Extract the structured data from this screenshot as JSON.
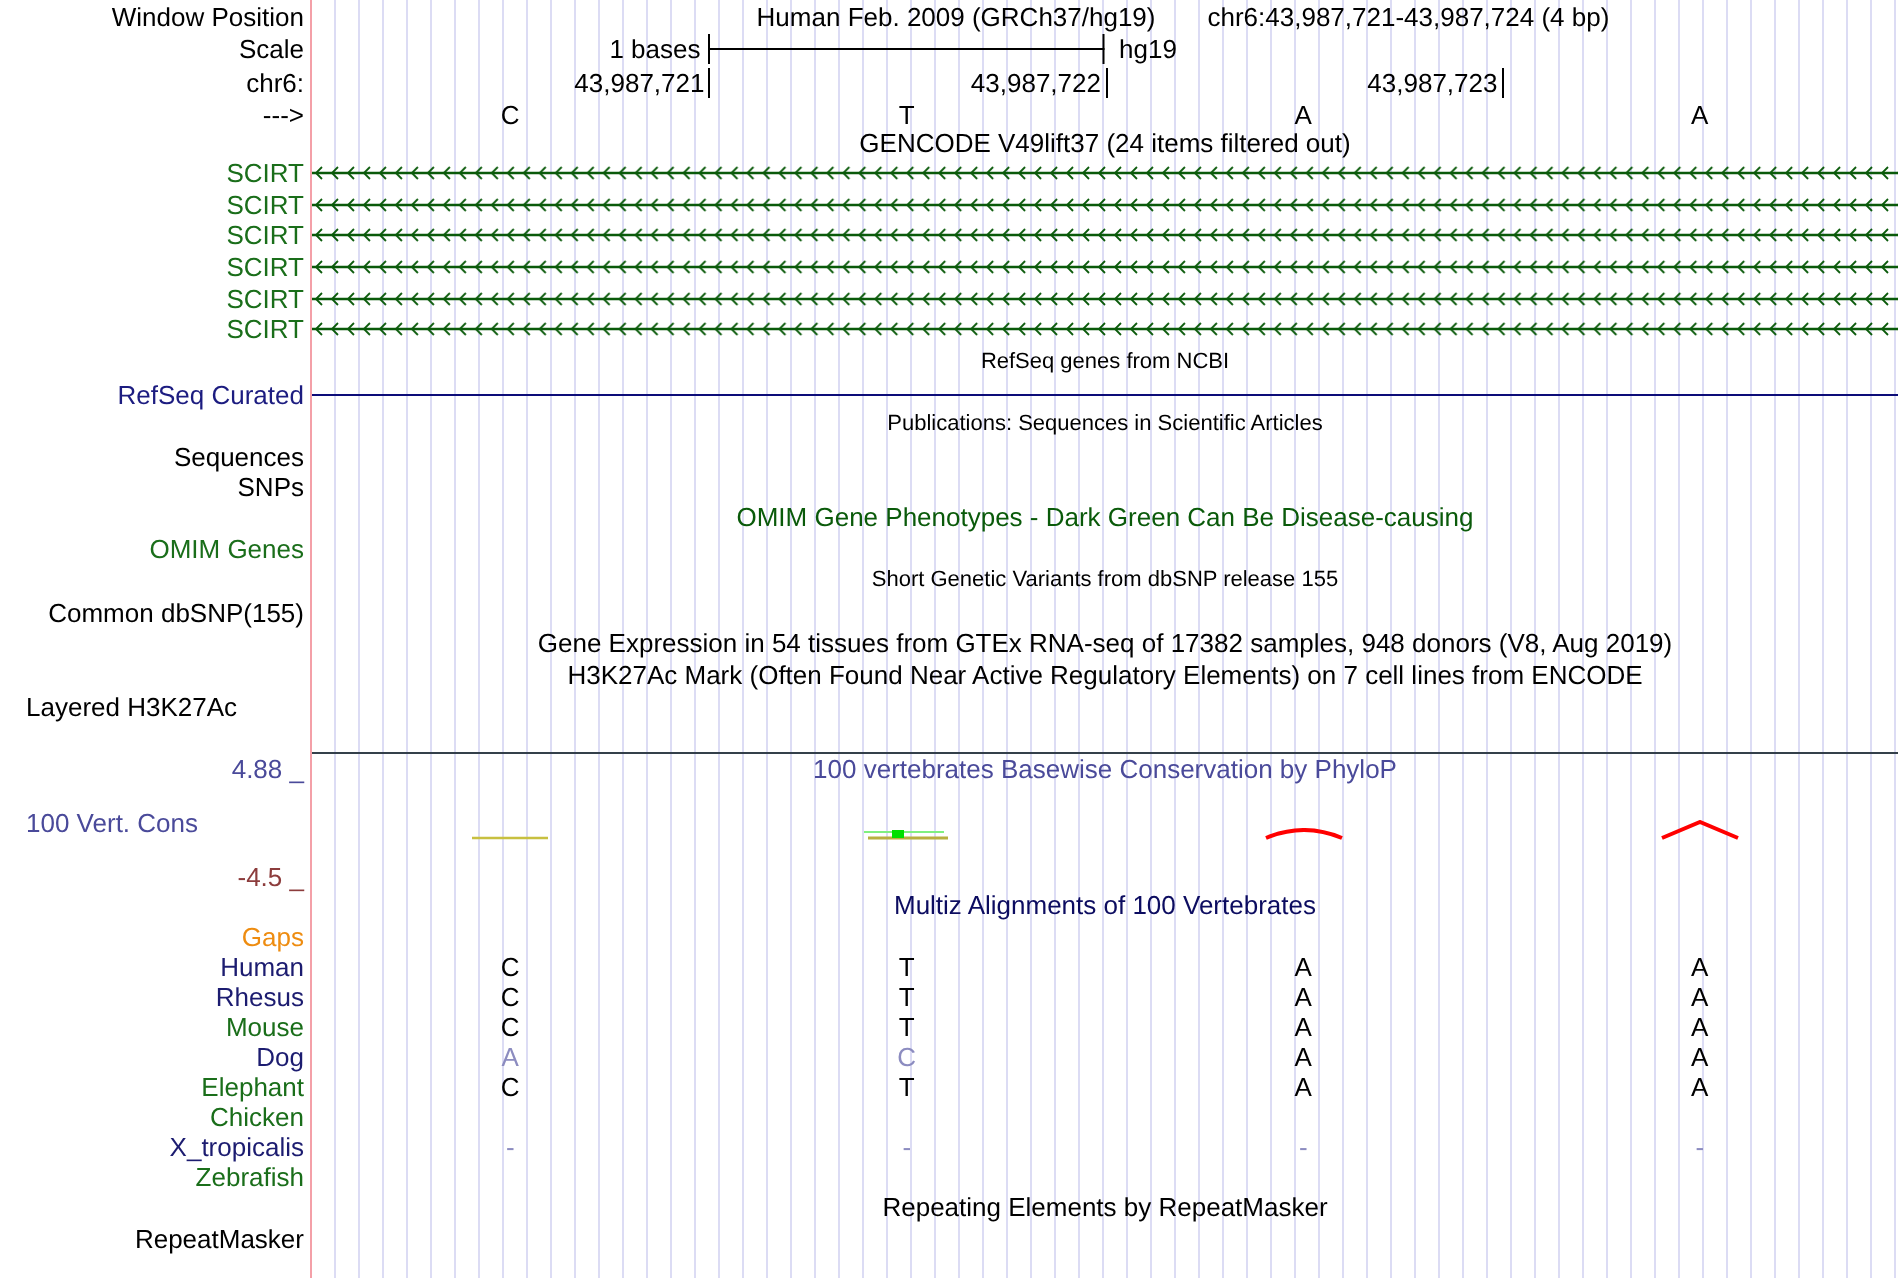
{
  "rows": [
    {
      "kind": "position",
      "label": {
        "text": "Window Position",
        "color": "#000000"
      },
      "texts": [
        "Human Feb. 2009 (GRCh37/hg19)",
        "chr6:43,987,721-43,987,724 (4 bp)"
      ]
    },
    {
      "kind": "scale",
      "label": {
        "text": "Scale",
        "color": "#000000"
      },
      "span": "1 bases",
      "assembly": "hg19"
    },
    {
      "kind": "ruler",
      "label": {
        "text": "chr6:",
        "color": "#000000"
      },
      "ticks": [
        "43,987,721",
        "43,987,722",
        "43,987,723"
      ]
    },
    {
      "kind": "bases",
      "label": {
        "text": "--->",
        "color": "#000000"
      },
      "bases": [
        {
          "base": "C",
          "mismatch": false
        },
        {
          "base": "T",
          "mismatch": false
        },
        {
          "base": "A",
          "mismatch": false
        },
        {
          "base": "A",
          "mismatch": false
        }
      ]
    },
    {
      "kind": "title",
      "text": "GENCODE V49lift37 (24 items filtered out)",
      "color": "#000000"
    },
    {
      "kind": "feature",
      "label": {
        "text": "SCIRT",
        "color": "#1a6e1a"
      },
      "color": "#0a5a0a"
    },
    {
      "kind": "feature",
      "label": {
        "text": "SCIRT",
        "color": "#1a6e1a"
      },
      "color": "#0a5a0a"
    },
    {
      "kind": "feature",
      "label": {
        "text": "SCIRT",
        "color": "#1a6e1a"
      },
      "color": "#0a5a0a"
    },
    {
      "kind": "feature",
      "label": {
        "text": "SCIRT",
        "color": "#1a6e1a"
      },
      "color": "#0a5a0a"
    },
    {
      "kind": "feature",
      "label": {
        "text": "SCIRT",
        "color": "#1a6e1a"
      },
      "color": "#0a5a0a"
    },
    {
      "kind": "feature",
      "label": {
        "text": "SCIRT",
        "color": "#1a6e1a"
      },
      "color": "#0a5a0a"
    },
    {
      "kind": "small-title",
      "text": "RefSeq genes from NCBI",
      "color": "#000000"
    },
    {
      "kind": "line",
      "label": {
        "text": "RefSeq Curated",
        "color": "#1c1c80"
      },
      "color": "#0c0c78"
    },
    {
      "kind": "small-title",
      "text": "Publications: Sequences in Scientific Articles",
      "color": "#000000"
    },
    {
      "kind": "label",
      "label": {
        "text": "Sequences",
        "color": "#000000"
      }
    },
    {
      "kind": "label",
      "label": {
        "text": "SNPs",
        "color": "#000000"
      }
    },
    {
      "kind": "title",
      "text": "OMIM Gene Phenotypes - Dark Green Can Be Disease-causing",
      "color": "#0a5a0a"
    },
    {
      "kind": "label",
      "label": {
        "text": "OMIM Genes",
        "color": "#1a6e1a"
      }
    },
    {
      "kind": "small-title",
      "text": "Short Genetic Variants from dbSNP release 155",
      "color": "#000000"
    },
    {
      "kind": "label",
      "label": {
        "text": "Common dbSNP(155)",
        "color": "#000000"
      }
    },
    {
      "kind": "title",
      "text": "Gene Expression in 54 tissues from GTEx RNA-seq of 17382 samples, 948 donors (V8, Aug 2019)",
      "color": "#000000"
    },
    {
      "kind": "title",
      "text": "H3K27Ac Mark (Often Found Near Active Regulatory Elements) on 7 cell lines from ENCODE",
      "color": "#000000"
    },
    {
      "kind": "side-label",
      "label": {
        "text": "Layered H3K27Ac",
        "color": "#000000"
      }
    },
    {
      "kind": "divider"
    },
    {
      "kind": "wiggle-title",
      "label": {
        "text": "4.88 _",
        "color": "#4a4a9a"
      },
      "text": "100 vertebrates Basewise Conservation by PhyloP",
      "color": "#4a4a9a"
    },
    {
      "kind": "wiggle",
      "label": {
        "text": "100 Vert. Cons",
        "color": "#4a4a9a"
      }
    },
    {
      "kind": "wiggle-min",
      "label": {
        "text": "-4.5 _",
        "color": "#8c3c3c"
      }
    },
    {
      "kind": "title",
      "text": "Multiz Alignments of 100 Vertebrates",
      "color": "#0c0c60"
    },
    {
      "kind": "species",
      "label": {
        "text": "Gaps",
        "color": "#ee8c10"
      }
    },
    {
      "kind": "species",
      "label": {
        "text": "Human",
        "color": "#1c1c70"
      },
      "bases": [
        {
          "base": "C",
          "mismatch": false
        },
        {
          "base": "T",
          "mismatch": false
        },
        {
          "base": "A",
          "mismatch": false
        },
        {
          "base": "A",
          "mismatch": false
        }
      ]
    },
    {
      "kind": "species",
      "label": {
        "text": "Rhesus",
        "color": "#1c1c70"
      },
      "bases": [
        {
          "base": "C",
          "mismatch": false
        },
        {
          "base": "T",
          "mismatch": false
        },
        {
          "base": "A",
          "mismatch": false
        },
        {
          "base": "A",
          "mismatch": false
        }
      ]
    },
    {
      "kind": "species",
      "label": {
        "text": "Mouse",
        "color": "#1a6e1a"
      },
      "bases": [
        {
          "base": "C",
          "mismatch": false
        },
        {
          "base": "T",
          "mismatch": false
        },
        {
          "base": "A",
          "mismatch": false
        },
        {
          "base": "A",
          "mismatch": false
        }
      ]
    },
    {
      "kind": "species",
      "label": {
        "text": "Dog",
        "color": "#1c1c70"
      },
      "bases": [
        {
          "base": "A",
          "mismatch": true
        },
        {
          "base": "C",
          "mismatch": true
        },
        {
          "base": "A",
          "mismatch": false
        },
        {
          "base": "A",
          "mismatch": false
        }
      ]
    },
    {
      "kind": "species",
      "label": {
        "text": "Elephant",
        "color": "#1a6e1a"
      },
      "bases": [
        {
          "base": "C",
          "mismatch": false
        },
        {
          "base": "T",
          "mismatch": false
        },
        {
          "base": "A",
          "mismatch": false
        },
        {
          "base": "A",
          "mismatch": false
        }
      ]
    },
    {
      "kind": "species",
      "label": {
        "text": "Chicken",
        "color": "#1a6e1a"
      }
    },
    {
      "kind": "species",
      "label": {
        "text": "X_tropicalis",
        "color": "#1c1c70"
      },
      "bases": [
        {
          "base": "-",
          "mismatch": true
        },
        {
          "base": "-",
          "mismatch": true
        },
        {
          "base": "-",
          "mismatch": true
        },
        {
          "base": "-",
          "mismatch": true
        }
      ]
    },
    {
      "kind": "species",
      "label": {
        "text": "Zebrafish",
        "color": "#1a6e1a"
      }
    },
    {
      "kind": "title",
      "text": "Repeating Elements by RepeatMasker",
      "color": "#000000"
    },
    {
      "kind": "label",
      "label": {
        "text": "RepeatMasker",
        "color": "#000000"
      }
    }
  ]
}
